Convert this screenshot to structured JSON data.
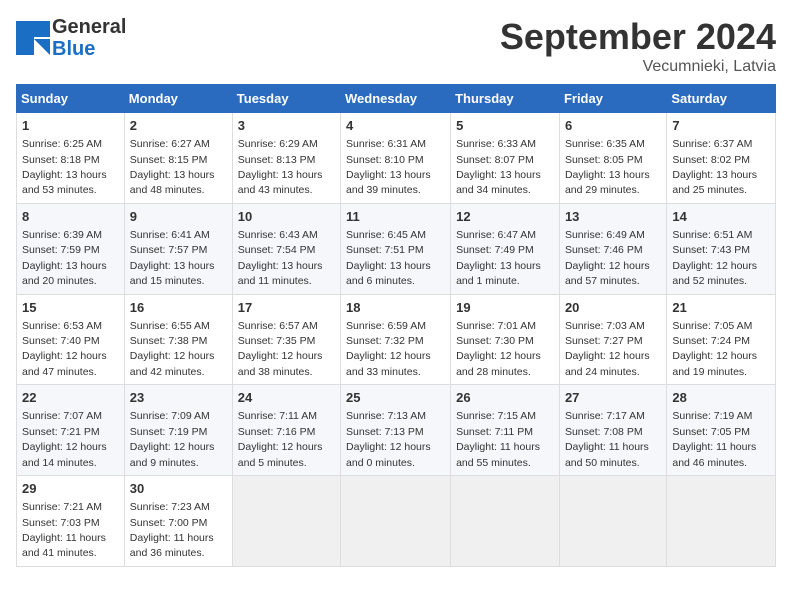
{
  "header": {
    "logo_general": "General",
    "logo_blue": "Blue",
    "month_title": "September 2024",
    "location": "Vecumnieki, Latvia"
  },
  "columns": [
    "Sunday",
    "Monday",
    "Tuesday",
    "Wednesday",
    "Thursday",
    "Friday",
    "Saturday"
  ],
  "weeks": [
    [
      {
        "day": "1",
        "sunrise": "Sunrise: 6:25 AM",
        "sunset": "Sunset: 8:18 PM",
        "daylight": "Daylight: 13 hours and 53 minutes."
      },
      {
        "day": "2",
        "sunrise": "Sunrise: 6:27 AM",
        "sunset": "Sunset: 8:15 PM",
        "daylight": "Daylight: 13 hours and 48 minutes."
      },
      {
        "day": "3",
        "sunrise": "Sunrise: 6:29 AM",
        "sunset": "Sunset: 8:13 PM",
        "daylight": "Daylight: 13 hours and 43 minutes."
      },
      {
        "day": "4",
        "sunrise": "Sunrise: 6:31 AM",
        "sunset": "Sunset: 8:10 PM",
        "daylight": "Daylight: 13 hours and 39 minutes."
      },
      {
        "day": "5",
        "sunrise": "Sunrise: 6:33 AM",
        "sunset": "Sunset: 8:07 PM",
        "daylight": "Daylight: 13 hours and 34 minutes."
      },
      {
        "day": "6",
        "sunrise": "Sunrise: 6:35 AM",
        "sunset": "Sunset: 8:05 PM",
        "daylight": "Daylight: 13 hours and 29 minutes."
      },
      {
        "day": "7",
        "sunrise": "Sunrise: 6:37 AM",
        "sunset": "Sunset: 8:02 PM",
        "daylight": "Daylight: 13 hours and 25 minutes."
      }
    ],
    [
      {
        "day": "8",
        "sunrise": "Sunrise: 6:39 AM",
        "sunset": "Sunset: 7:59 PM",
        "daylight": "Daylight: 13 hours and 20 minutes."
      },
      {
        "day": "9",
        "sunrise": "Sunrise: 6:41 AM",
        "sunset": "Sunset: 7:57 PM",
        "daylight": "Daylight: 13 hours and 15 minutes."
      },
      {
        "day": "10",
        "sunrise": "Sunrise: 6:43 AM",
        "sunset": "Sunset: 7:54 PM",
        "daylight": "Daylight: 13 hours and 11 minutes."
      },
      {
        "day": "11",
        "sunrise": "Sunrise: 6:45 AM",
        "sunset": "Sunset: 7:51 PM",
        "daylight": "Daylight: 13 hours and 6 minutes."
      },
      {
        "day": "12",
        "sunrise": "Sunrise: 6:47 AM",
        "sunset": "Sunset: 7:49 PM",
        "daylight": "Daylight: 13 hours and 1 minute."
      },
      {
        "day": "13",
        "sunrise": "Sunrise: 6:49 AM",
        "sunset": "Sunset: 7:46 PM",
        "daylight": "Daylight: 12 hours and 57 minutes."
      },
      {
        "day": "14",
        "sunrise": "Sunrise: 6:51 AM",
        "sunset": "Sunset: 7:43 PM",
        "daylight": "Daylight: 12 hours and 52 minutes."
      }
    ],
    [
      {
        "day": "15",
        "sunrise": "Sunrise: 6:53 AM",
        "sunset": "Sunset: 7:40 PM",
        "daylight": "Daylight: 12 hours and 47 minutes."
      },
      {
        "day": "16",
        "sunrise": "Sunrise: 6:55 AM",
        "sunset": "Sunset: 7:38 PM",
        "daylight": "Daylight: 12 hours and 42 minutes."
      },
      {
        "day": "17",
        "sunrise": "Sunrise: 6:57 AM",
        "sunset": "Sunset: 7:35 PM",
        "daylight": "Daylight: 12 hours and 38 minutes."
      },
      {
        "day": "18",
        "sunrise": "Sunrise: 6:59 AM",
        "sunset": "Sunset: 7:32 PM",
        "daylight": "Daylight: 12 hours and 33 minutes."
      },
      {
        "day": "19",
        "sunrise": "Sunrise: 7:01 AM",
        "sunset": "Sunset: 7:30 PM",
        "daylight": "Daylight: 12 hours and 28 minutes."
      },
      {
        "day": "20",
        "sunrise": "Sunrise: 7:03 AM",
        "sunset": "Sunset: 7:27 PM",
        "daylight": "Daylight: 12 hours and 24 minutes."
      },
      {
        "day": "21",
        "sunrise": "Sunrise: 7:05 AM",
        "sunset": "Sunset: 7:24 PM",
        "daylight": "Daylight: 12 hours and 19 minutes."
      }
    ],
    [
      {
        "day": "22",
        "sunrise": "Sunrise: 7:07 AM",
        "sunset": "Sunset: 7:21 PM",
        "daylight": "Daylight: 12 hours and 14 minutes."
      },
      {
        "day": "23",
        "sunrise": "Sunrise: 7:09 AM",
        "sunset": "Sunset: 7:19 PM",
        "daylight": "Daylight: 12 hours and 9 minutes."
      },
      {
        "day": "24",
        "sunrise": "Sunrise: 7:11 AM",
        "sunset": "Sunset: 7:16 PM",
        "daylight": "Daylight: 12 hours and 5 minutes."
      },
      {
        "day": "25",
        "sunrise": "Sunrise: 7:13 AM",
        "sunset": "Sunset: 7:13 PM",
        "daylight": "Daylight: 12 hours and 0 minutes."
      },
      {
        "day": "26",
        "sunrise": "Sunrise: 7:15 AM",
        "sunset": "Sunset: 7:11 PM",
        "daylight": "Daylight: 11 hours and 55 minutes."
      },
      {
        "day": "27",
        "sunrise": "Sunrise: 7:17 AM",
        "sunset": "Sunset: 7:08 PM",
        "daylight": "Daylight: 11 hours and 50 minutes."
      },
      {
        "day": "28",
        "sunrise": "Sunrise: 7:19 AM",
        "sunset": "Sunset: 7:05 PM",
        "daylight": "Daylight: 11 hours and 46 minutes."
      }
    ],
    [
      {
        "day": "29",
        "sunrise": "Sunrise: 7:21 AM",
        "sunset": "Sunset: 7:03 PM",
        "daylight": "Daylight: 11 hours and 41 minutes."
      },
      {
        "day": "30",
        "sunrise": "Sunrise: 7:23 AM",
        "sunset": "Sunset: 7:00 PM",
        "daylight": "Daylight: 11 hours and 36 minutes."
      },
      null,
      null,
      null,
      null,
      null
    ]
  ]
}
